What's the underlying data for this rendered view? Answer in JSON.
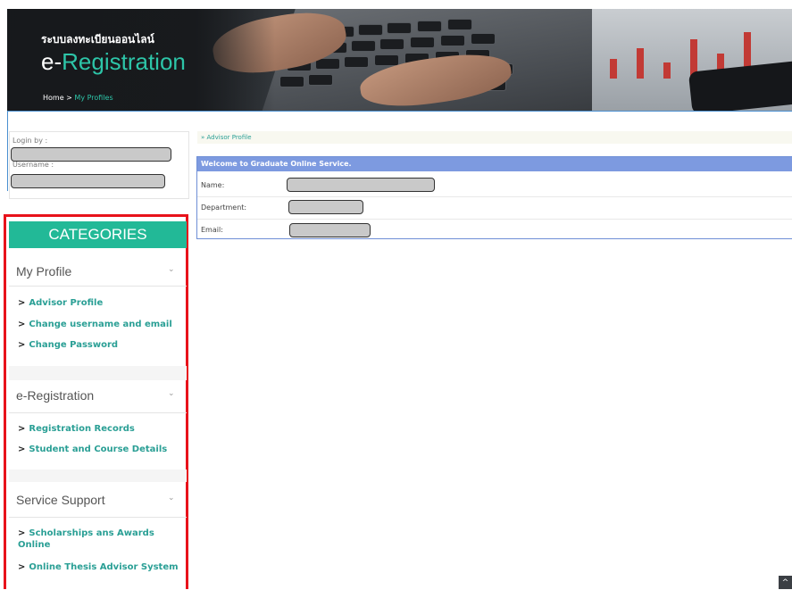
{
  "header": {
    "thai_title": "ระบบลงทะเบียนออนไลน์",
    "title_prefix": "e-",
    "title_main": "Registration",
    "breadcrumb_home": "Home",
    "breadcrumb_sep": ">",
    "breadcrumb_current": "My Profiles"
  },
  "login": {
    "login_by_label": "Login by :",
    "username_label": "Username :"
  },
  "categories": {
    "title": "CATEGORIES",
    "groups": [
      {
        "title": "My Profile",
        "chevron": "chevron-down-icon",
        "links": [
          "Advisor Profile",
          "Change username and email",
          "Change Password"
        ]
      },
      {
        "title": "e-Registration",
        "chevron": "chevron-down-icon",
        "links": [
          "Registration Records",
          "Student and Course Details"
        ]
      },
      {
        "title": "Service Support",
        "chevron": "chevron-down-icon",
        "links": [
          "Scholarships ans Awards Online",
          "Online Thesis Advisor System"
        ]
      }
    ]
  },
  "main": {
    "breadcrumb": "» Advisor Profile",
    "welcome": "Welcome to Graduate Online Service.",
    "fields": [
      {
        "label": "Name:"
      },
      {
        "label": "Department:"
      },
      {
        "label": "Email:"
      }
    ]
  },
  "icons": {
    "arrow": ">",
    "chevron": "⌄",
    "scroll_top": "^"
  },
  "colors": {
    "accent": "#22b997",
    "link": "#2a9f95",
    "welcome_bar": "#7d9ae0",
    "highlight": "#e8121b"
  }
}
